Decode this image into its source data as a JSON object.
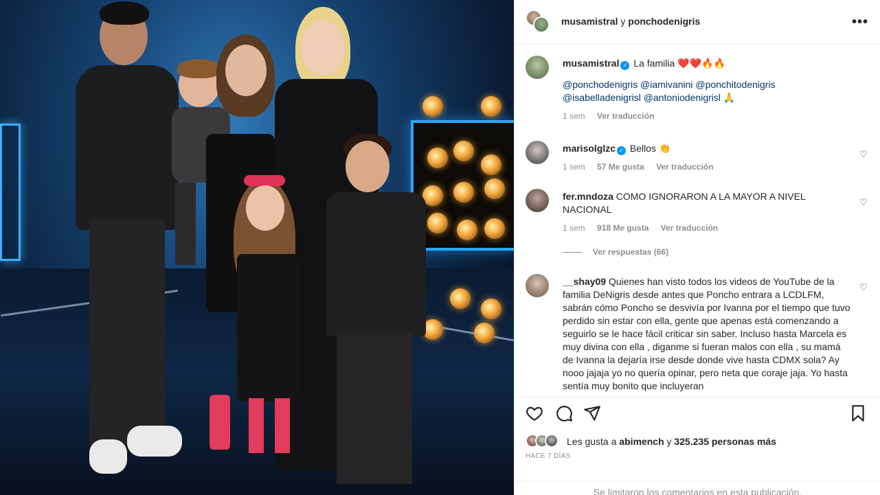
{
  "post": {
    "authors_primary": "musamistral",
    "authors_conj": "y",
    "authors_secondary": "ponchodenigris",
    "more_icon": "more-horizontal-icon"
  },
  "caption": {
    "user": "musamistral",
    "text": "La familia",
    "emoji": "❤️❤️🔥🔥",
    "mentions_line1": "@ponchodenigris @iamivanini @ponchitodenigris",
    "mentions_line2": "@isabelladenigrisl @antoniodenigrisl 🙏",
    "time": "1 sem",
    "translate": "Ver traducción"
  },
  "comments": [
    {
      "user": "marisolglzc",
      "text": "Bellos 👏",
      "time": "1 sem",
      "likes": "57 Me gusta",
      "translate": "Ver traducción"
    },
    {
      "user": "fer.mndoza",
      "text": "COMO IGNORARON A LA MAYOR A NIVEL NACIONAL",
      "time": "1 sem",
      "likes": "918 Me gusta",
      "translate": "Ver traducción",
      "replies": "Ver respuestas (66)"
    },
    {
      "user": "__shay09",
      "text": "Quienes han visto todos los videos de YouTube de la familia DeNigris desde antes que Poncho entrara a LCDLFM, sabrán cómo Poncho se desvivía por Ivanna por el tiempo que tuvo perdido sin estar con ella, gente que apenas está comenzando a seguirlo se le hace fácil criticar sin saber. Incluso hasta Marcela es muy divina con ella , diganme si fueran malos con ella , su mamá de Ivanna la dejaría irse desde donde vive hasta CDMX sola? Ay nooo jajaja yo no quería opinar, pero neta que coraje jaja. Yo hasta sentía muy bonito que incluyeran"
    }
  ],
  "likes": {
    "prefix": "Les gusta a",
    "user": "abimench",
    "conj": "y",
    "count": "325.235 personas más"
  },
  "date": "HACE 7 DÍAS",
  "footer": "Se limitaron los comentarios en esta publicación.",
  "colors": {
    "link": "#00376b",
    "verified": "#0095f6",
    "muted": "#8e8e8e"
  }
}
